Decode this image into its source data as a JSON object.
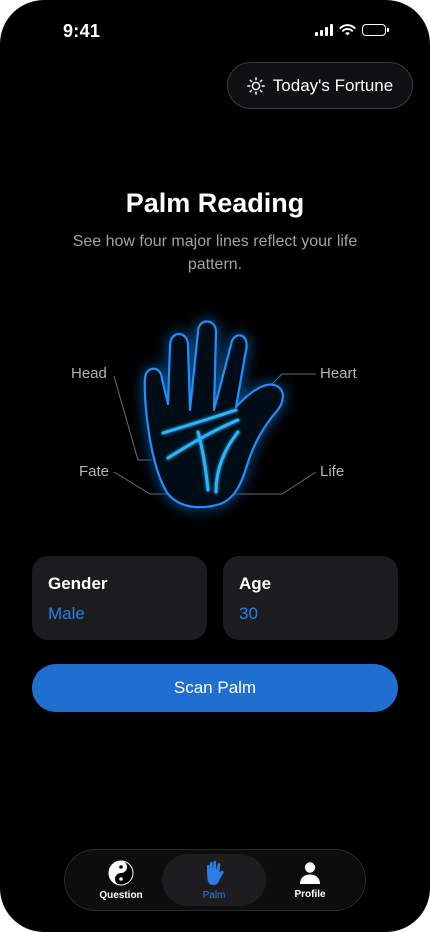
{
  "status_bar": {
    "time": "9:41",
    "icons": [
      "cellular-signal-icon",
      "wifi-icon",
      "battery-icon"
    ]
  },
  "header": {
    "fortune_button": {
      "icon": "sun-icon",
      "label": "Today's Fortune"
    }
  },
  "main": {
    "title": "Palm Reading",
    "subtitle": "See how four major lines reflect your life pattern.",
    "palm_lines": {
      "head": "Head",
      "heart": "Heart",
      "fate": "Fate",
      "life": "Life"
    },
    "cards": {
      "gender": {
        "label": "Gender",
        "value": "Male"
      },
      "age": {
        "label": "Age",
        "value": "30"
      }
    },
    "scan_button_label": "Scan Palm"
  },
  "tab_bar": {
    "items": [
      {
        "label": "Question",
        "icon": "yin-yang-icon",
        "active": false
      },
      {
        "label": "Palm",
        "icon": "hand-icon",
        "active": true
      },
      {
        "label": "Profile",
        "icon": "person-icon",
        "active": false
      }
    ]
  },
  "colors": {
    "background": "#000000",
    "accent": "#2b7de9",
    "button": "#1f6fd1",
    "card": "#1c1c1e",
    "palm_glow": "#1e90ff",
    "palm_line": "#29b6ff"
  }
}
